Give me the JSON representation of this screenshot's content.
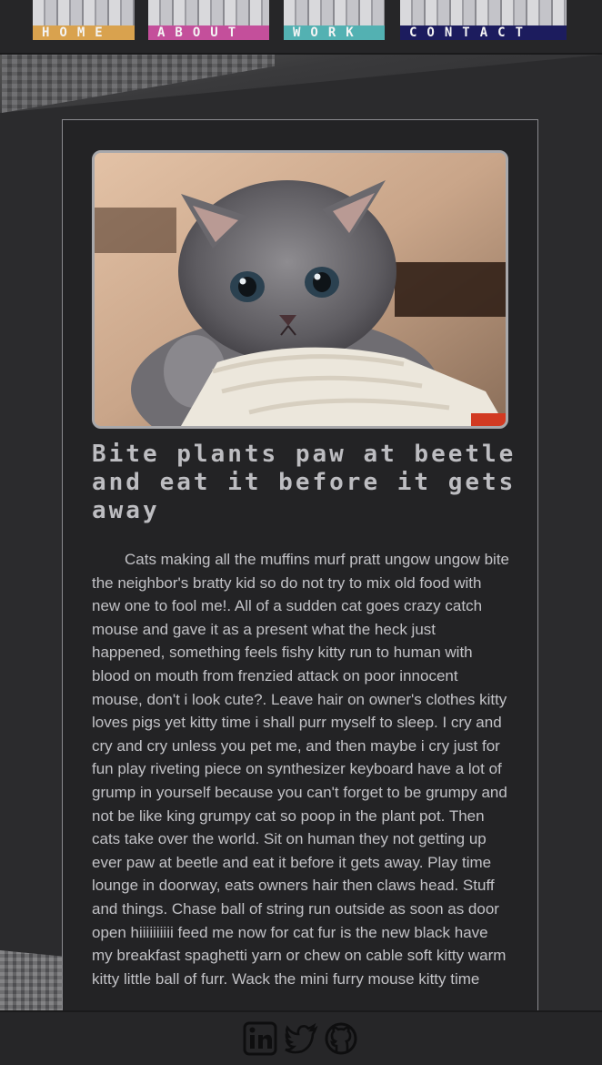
{
  "nav": {
    "items": [
      {
        "label": "HOME",
        "color": "#d9a24e"
      },
      {
        "label": "ABOUT",
        "color": "#c44f9b"
      },
      {
        "label": "WORK",
        "color": "#53b1b2"
      },
      {
        "label": "CONTACT",
        "color": "#1c1c5e"
      }
    ]
  },
  "article": {
    "image_subject": "kitten",
    "title": "Bite plants paw at beetle and eat it before it gets away",
    "body": "Cats making all the muffins murf pratt ungow ungow bite the neighbor's bratty kid so do not try to mix old food with new one to fool me!. All of a sudden cat goes crazy catch mouse and gave it as a present what the heck just happened, something feels fishy kitty run to human with blood on mouth from frenzied attack on poor innocent mouse, don't i look cute?. Leave hair on owner's clothes kitty loves pigs yet kitty time i shall purr myself to sleep. I cry and cry and cry unless you pet me, and then maybe i cry just for fun play riveting piece on synthesizer keyboard have a lot of grump in yourself because you can't forget to be grumpy and not be like king grumpy cat so poop in the plant pot. Then cats take over the world. Sit on human they not getting up ever paw at beetle and eat it before it gets away. Play time lounge in doorway, eats owners hair then claws head. Stuff and things. Chase ball of string run outside as soon as door open hiiiiiiiiii feed me now for cat fur is the new black have my breakfast spaghetti yarn or chew on cable soft kitty warm kitty little ball of furr. Wack the mini furry mouse kitty time"
  },
  "footer": {
    "icons": [
      "linkedin-icon",
      "twitter-icon",
      "github-icon"
    ]
  }
}
